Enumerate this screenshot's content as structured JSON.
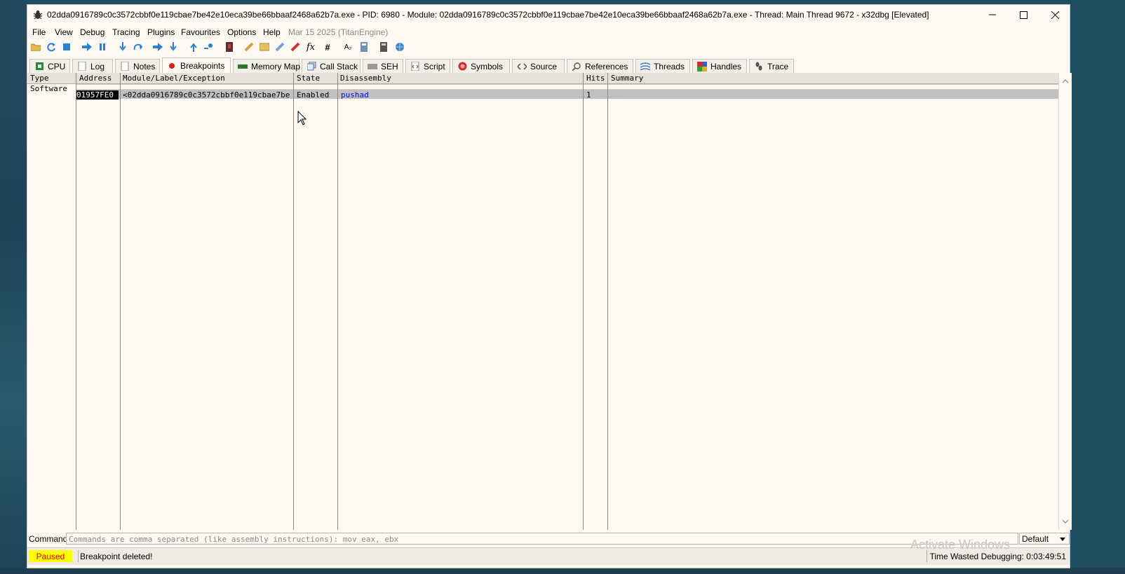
{
  "window": {
    "title": "02dda0916789c0c3572cbbf0e119cbae7be42e10eca39be66bbaaf2468a62b7a.exe - PID: 6980 - Module: 02dda0916789c0c3572cbbf0e119cbae7be42e10eca39be66bbaaf2468a62b7a.exe - Thread: Main Thread 9672 - x32dbg [Elevated]",
    "app_icon": "bug-icon"
  },
  "menu": {
    "items": [
      "File",
      "View",
      "Debug",
      "Tracing",
      "Plugins",
      "Favourites",
      "Options",
      "Help"
    ],
    "date": "Mar 15 2025 (TitanEngine)"
  },
  "toolbar": {
    "icons": [
      "open-icon",
      "restart-icon",
      "stop-icon",
      "run-icon",
      "pause-icon",
      "step-into-icon",
      "step-over-icon",
      "trace-into-icon",
      "trace-over-icon",
      "execute-till-return-icon",
      "run-to-user-code-icon",
      "scylla-icon",
      "patch-icon",
      "comment-icon",
      "label-icon",
      "bookmark-icon",
      "function-icon",
      "hash-icon",
      "strings-icon",
      "calls-icon",
      "calculator-icon",
      "globe-icon"
    ],
    "fx_label": "fx",
    "hash_label": "#",
    "strings_label": "A₂"
  },
  "tabs": [
    {
      "label": "CPU",
      "icon": "cpu-icon"
    },
    {
      "label": "Log",
      "icon": "log-icon"
    },
    {
      "label": "Notes",
      "icon": "notes-icon"
    },
    {
      "label": "Breakpoints",
      "icon": "breakpoint-icon",
      "active": true
    },
    {
      "label": "Memory Map",
      "icon": "memory-map-icon"
    },
    {
      "label": "Call Stack",
      "icon": "call-stack-icon"
    },
    {
      "label": "SEH",
      "icon": "seh-icon"
    },
    {
      "label": "Script",
      "icon": "script-icon"
    },
    {
      "label": "Symbols",
      "icon": "symbols-icon"
    },
    {
      "label": "Source",
      "icon": "source-icon"
    },
    {
      "label": "References",
      "icon": "references-icon"
    },
    {
      "label": "Threads",
      "icon": "threads-icon"
    },
    {
      "label": "Handles",
      "icon": "handles-icon"
    },
    {
      "label": "Trace",
      "icon": "trace-icon"
    }
  ],
  "breakpoints": {
    "columns": [
      "Type",
      "Address",
      "Module/Label/Exception",
      "State",
      "Disassembly",
      "Hits",
      "Summary"
    ],
    "group": "Software",
    "rows": [
      {
        "type": "",
        "address": "01957FE0",
        "module": "<02dda0916789c0c3572cbbf0e119cbae7be",
        "state": "Enabled",
        "disassembly": "pushad",
        "hits": "1",
        "summary": ""
      }
    ]
  },
  "command": {
    "label": "Command:",
    "placeholder": "Commands are comma separated (like assembly instructions): mov eax, ebx",
    "mode": "Default"
  },
  "status": {
    "state": "Paused",
    "message": "Breakpoint deleted!",
    "time_wasted": "Time Wasted Debugging: 0:03:49:51"
  },
  "overlay": {
    "activate_windows": "Activate Windows"
  },
  "colors": {
    "window_bg": "#fdf8f1",
    "paused_bg": "#ffff00",
    "paused_text": "#dd0000",
    "disasm_text": "#0000ff",
    "selected_row": "#c0c0c0"
  }
}
